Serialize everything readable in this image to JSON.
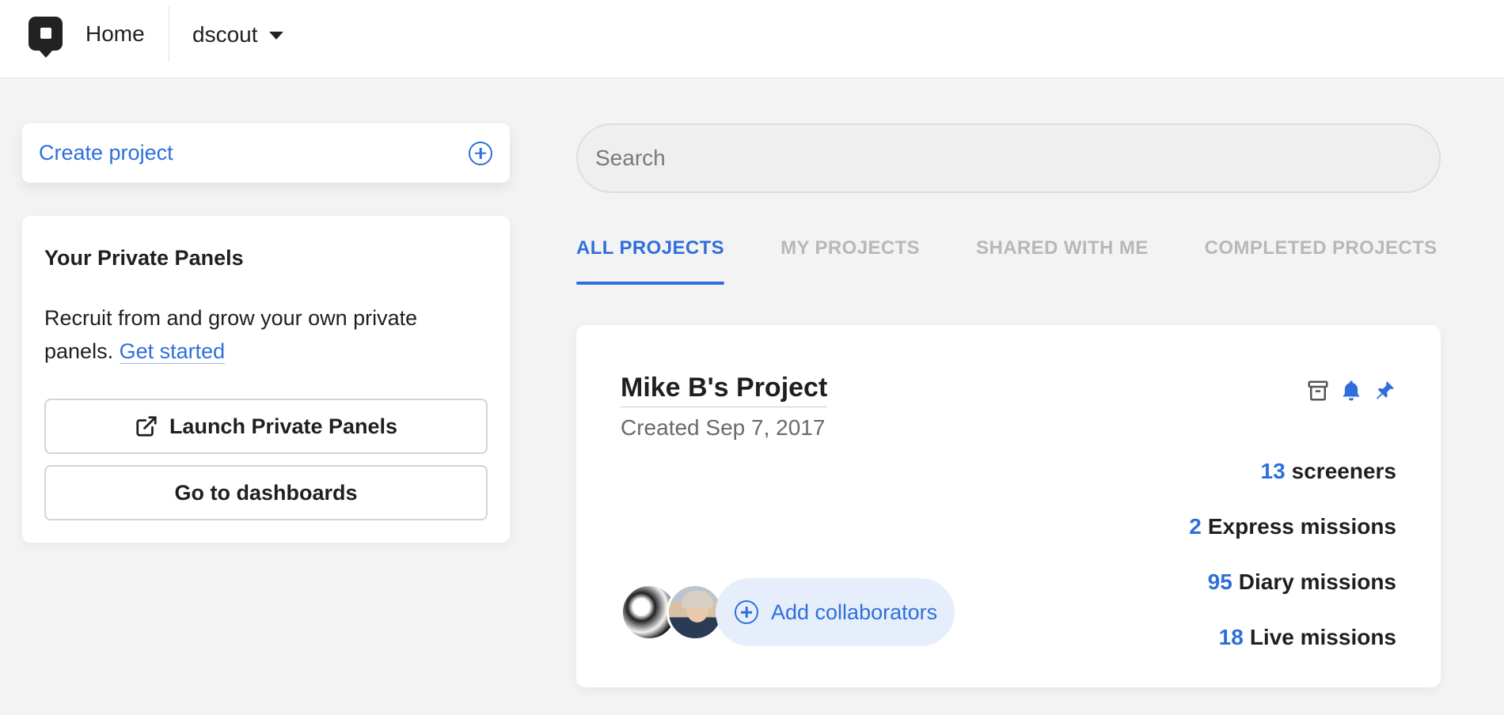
{
  "topbar": {
    "logo": "dscout-logo-icon",
    "home_label": "Home",
    "org_name": "dscout"
  },
  "sidebar": {
    "create_project_label": "Create project",
    "private_panels": {
      "title": "Your Private Panels",
      "description": "Recruit from and grow your own private panels.",
      "link_label": "Get started",
      "launch_button": "Launch Private Panels",
      "dashboards_button": "Go to dashboards"
    }
  },
  "search": {
    "placeholder": "Search",
    "value": ""
  },
  "tabs": [
    {
      "label": "ALL PROJECTS",
      "active": true
    },
    {
      "label": "MY PROJECTS",
      "active": false
    },
    {
      "label": "SHARED WITH ME",
      "active": false
    },
    {
      "label": "COMPLETED PROJECTS",
      "active": false
    }
  ],
  "project": {
    "title": "Mike B's Project",
    "created": "Created Sep 7, 2017",
    "icons": [
      "archive-icon",
      "bell-icon",
      "pin-icon"
    ],
    "stats": [
      {
        "count": "13",
        "label": "screeners"
      },
      {
        "count": "2",
        "label": "Express missions"
      },
      {
        "count": "95",
        "label": "Diary missions"
      },
      {
        "count": "18",
        "label": "Live missions"
      }
    ],
    "add_collaborators_label": "Add collaborators"
  },
  "colors": {
    "accent": "#2f6fdb",
    "background": "#f3f3f3",
    "tab_inactive": "#b8b8b8",
    "collab_bg": "#e6eefc"
  }
}
